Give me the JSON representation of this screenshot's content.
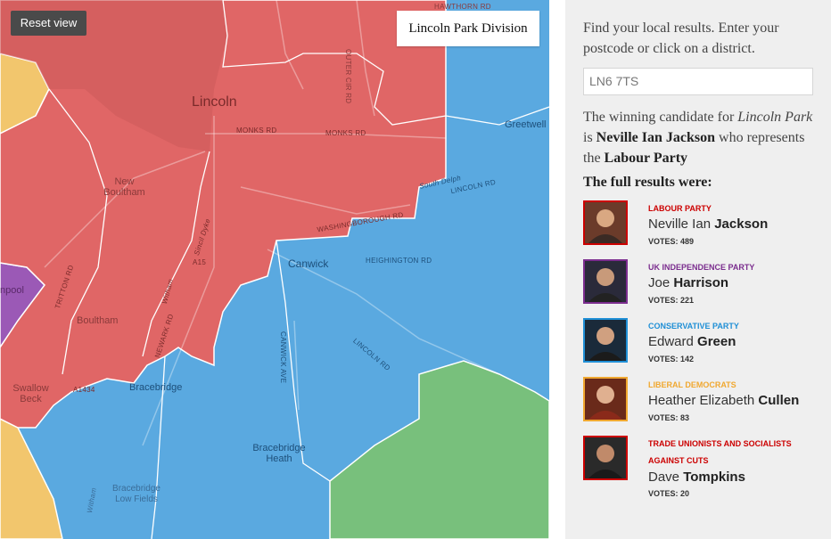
{
  "map": {
    "reset_label": "Reset view",
    "selected_division": "Lincoln Park Division",
    "colors": {
      "labour": "#e06666",
      "conservative": "#5aa9e0",
      "green_area": "#78c07c",
      "libdem": "#f2c66d",
      "ukip": "#9b59b6"
    },
    "places": [
      {
        "name": "Lincoln"
      },
      {
        "name": "New Boultham"
      },
      {
        "name": "Canwick"
      },
      {
        "name": "Boultham"
      },
      {
        "name": "Bracebridge"
      },
      {
        "name": "Bracebridge Heath"
      },
      {
        "name": "Swallow Beck"
      },
      {
        "name": "Bracebridge Low Fields"
      },
      {
        "name": "Greetwell"
      },
      {
        "name": "npool"
      }
    ],
    "roads": [
      "HAWTHORN RD",
      "OUTER CIR RD",
      "MONKS RD",
      "MONKS RD",
      "South Delph",
      "LINCOLN RD",
      "WASHINGBOROUGH RD",
      "HEIGHINGTON RD",
      "A15",
      "Sincil Dyke",
      "TRITTON RD",
      "NEWARK RD",
      "Witham",
      "CANWICK AVE",
      "LINCOLN RD",
      "A1434",
      "Witham"
    ]
  },
  "panel": {
    "intro": "Find your local results. Enter your postcode or click on a district.",
    "postcode_value": "LN6 7TS",
    "winner_prefix": "The winning candidate for ",
    "winner_division": "Lincoln Park",
    "winner_is": " is ",
    "winner_name": "Neville Ian Jackson",
    "winner_represents": " who represents the ",
    "winner_party": "Labour Party",
    "full_results_title": "The full results were:",
    "results": [
      {
        "party": "LABOUR PARTY",
        "party_color": "#cc0000",
        "first": "Neville Ian ",
        "last": "Jackson",
        "votes": "VOTES: 489",
        "photo_icon": "candidate-photo"
      },
      {
        "party": "UK INDEPENDENCE PARTY",
        "party_color": "#7b2d8e",
        "first": "Joe ",
        "last": "Harrison",
        "votes": "VOTES: 221",
        "photo_icon": "candidate-photo"
      },
      {
        "party": "CONSERVATIVE PARTY",
        "party_color": "#1f8fd6",
        "first": "Edward ",
        "last": "Green",
        "votes": "VOTES: 142",
        "photo_icon": "candidate-photo"
      },
      {
        "party": "LIBERAL DEMOCRATS",
        "party_color": "#f0a830",
        "first": "Heather Elizabeth ",
        "last": "Cullen",
        "votes": "VOTES: 83",
        "photo_icon": "candidate-photo"
      },
      {
        "party": "TRADE UNIONISTS AND SOCIALISTS AGAINST CUTS",
        "party_color": "#cc0000",
        "first": "Dave ",
        "last": "Tompkins",
        "votes": "VOTES: 20",
        "photo_icon": "candidate-photo"
      }
    ]
  }
}
